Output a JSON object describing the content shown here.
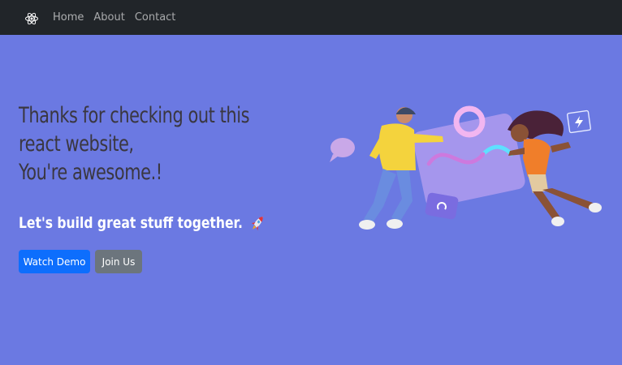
{
  "nav": {
    "brand_icon": "react-logo-icon",
    "links": [
      {
        "label": "Home"
      },
      {
        "label": "About"
      },
      {
        "label": "Contact"
      }
    ]
  },
  "hero": {
    "title_lines": [
      "Thanks for checking out this",
      "react website,",
      "You're awesome.!"
    ],
    "tagline": "Let's build great stuff together.",
    "tagline_icon": "rocket-icon",
    "buttons": {
      "primary": "Watch Demo",
      "secondary": "Join Us"
    }
  },
  "colors": {
    "background": "#6b79e2",
    "navbar": "#212529",
    "primary_button": "#0d6efd",
    "secondary_button": "#6c757d",
    "title_text": "#3a3740"
  }
}
